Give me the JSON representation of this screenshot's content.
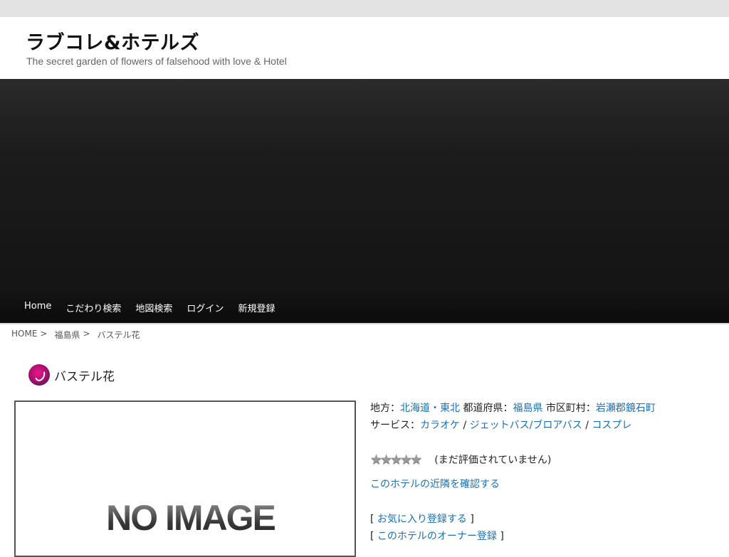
{
  "site": {
    "title": "ラブコレ&ホテルズ",
    "description": "The secret garden of flowers of falsehood with love & Hotel"
  },
  "nav": {
    "items": [
      "Home",
      "こだわり検索",
      "地図検索",
      "ログイン",
      "新規登録"
    ]
  },
  "breadcrumb": {
    "home": "HOME",
    "prefecture": "福島県",
    "current": "バステル花",
    "separator": ">"
  },
  "hotel": {
    "name": "バステル花",
    "photo_placeholder": "NO IMAGE",
    "region_label": "地方：",
    "region": "北海道・東北",
    "prefecture_label": "都道府県：",
    "prefecture": "福島県",
    "city_label": "市区町村：",
    "city": "岩瀬郡鏡石町",
    "services_label": "サービス：",
    "services": [
      "カラオケ",
      "ジェットバス/ブロアバス",
      "コスプレ"
    ],
    "service_separator": "/",
    "rating": 0,
    "rating_max": 5,
    "rating_text": "(まだ評価されていません)",
    "nearby_link": "このホテルの近隣を確認する",
    "favorite_link": "お気に入り登録する",
    "owner_link": "このホテルのオーナー登録"
  },
  "colors": {
    "link": "#1a6fb5",
    "header_bg": "#e3e3e3",
    "hero_bg": "#1c1c1c"
  }
}
